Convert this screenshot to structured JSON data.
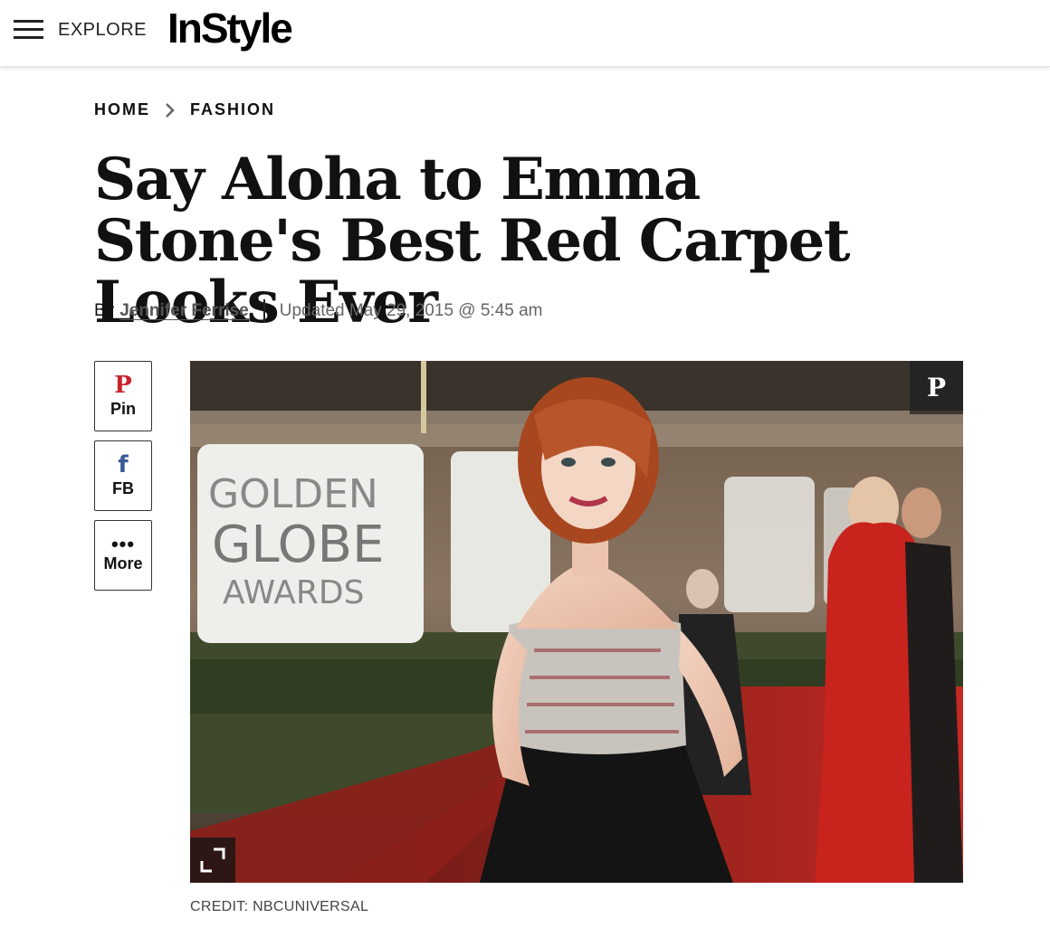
{
  "header": {
    "menu_icon": "hamburger-icon",
    "explore_label": "EXPLORE",
    "logo_text": "InStyle"
  },
  "breadcrumb": {
    "items": [
      "HOME",
      "FASHION"
    ],
    "separator_icon": "chevron-right-icon"
  },
  "article": {
    "title": "Say Aloha to Emma Stone's Best Red Carpet Looks Ever",
    "byline_prefix": "By",
    "author": "Jennifer Ferrise",
    "updated": "Updated May 29, 2015 @ 5:45 am"
  },
  "share": {
    "pin_label": "Pin",
    "pin_icon": "pinterest-icon",
    "fb_label": "FB",
    "fb_icon": "facebook-icon",
    "more_label": "More",
    "more_icon": "ellipsis-icon"
  },
  "hero": {
    "pin_icon": "pinterest-icon",
    "expand_icon": "expand-icon",
    "sign_text": [
      "GOLDEN",
      "GLOBE",
      "AWARDS"
    ],
    "credit": "CREDIT: NBCUNIVERSAL"
  },
  "colors": {
    "pinterest_red": "#c8232c",
    "facebook_blue": "#3b5998",
    "carpet_red": "#b8231f"
  }
}
